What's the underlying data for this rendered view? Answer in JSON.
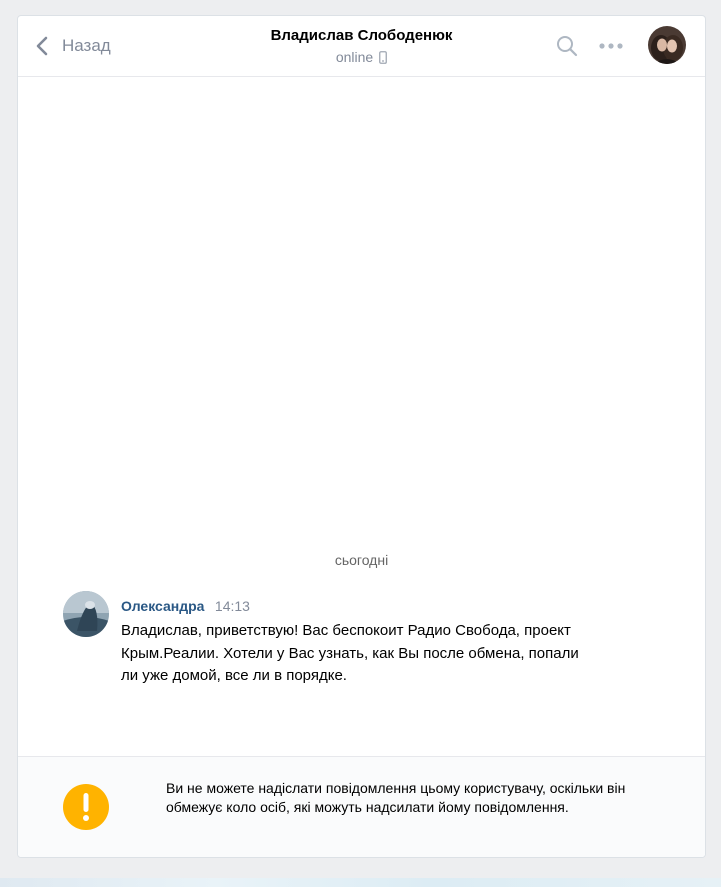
{
  "header": {
    "back_label": "Назад",
    "peer_name": "Владислав Слободенюк",
    "peer_status": "online"
  },
  "history": {
    "day_separator": "сьогодні",
    "messages": [
      {
        "author": "Олександра",
        "time": "14:13",
        "text": "Владислав, приветствую! Вас беспокоит Радио Свобода, проект Крым.Реалии. Хотели у Вас узнать, как Вы после обмена, попали ли уже домой, все ли в порядке."
      }
    ]
  },
  "footer": {
    "notice": "Ви не можете надіслати повідомлення цьому користувачу, оскільки він обмежує коло осіб, які можуть надсилати йому повідомлення."
  },
  "colors": {
    "page_bg": "#edeef0",
    "accent_link": "#2a5885",
    "muted_text": "#828a99",
    "warning": "#ffb300"
  },
  "icons": [
    "chevron-left-icon",
    "mobile-phone-icon",
    "search-icon",
    "more-icon",
    "warning-icon"
  ]
}
